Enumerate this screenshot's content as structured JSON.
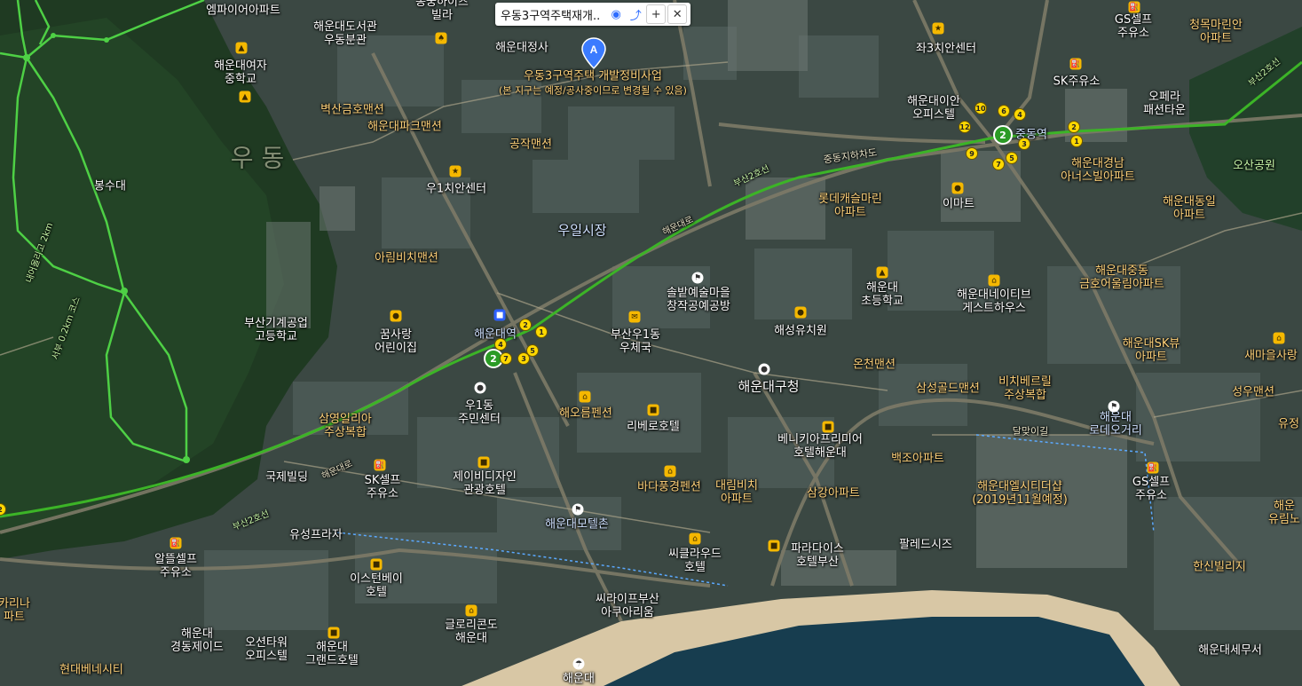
{
  "popup": {
    "title": "우동3구역주택재개.."
  },
  "pin_letter": "A",
  "notice": {
    "line1": "우동3구역주택 개발정비사업",
    "line2": "(본 지구는 예정/공사중이므로 변경될 수 있음)"
  },
  "subway_line": "2",
  "labels": {
    "empire": "엠파이어아파트",
    "haeundae_library": "해운대도서관\n우동분관",
    "villa": "동궁하이츠\n빌라",
    "haeundae_temple": "해운대정사",
    "girls_ms": "해운대여자\n중학교",
    "byeoksan": "벽산금호맨션",
    "park_mansion": "해운대파크맨션",
    "gongjak": "공작맨션",
    "u1_center": "우1치안센터",
    "u_dong": "우  동",
    "bongsudae": "봉수대",
    "trail1": "내어올리고 2km",
    "trail2": "서부 0.2km 코스",
    "uil_market": "우일시장",
    "arim": "아림비치맨션",
    "busan_mech": "부산기계공업\n고등학교",
    "dream_kinder": "꿈사랑\n어린이집",
    "haeundae_stn": "해운대역",
    "u1dong_center": "우1동\n주민센터",
    "samyoung": "삼영일리아\n주상복합",
    "haeoreum": "해오름펜션",
    "riviera": "리베로호텔",
    "solbat": "솔밭예술마을\n창작공예공방",
    "busan_post": "부산우1동\n우체국",
    "haeseong_kinder": "해성유치원",
    "gu_office": "해운대구청",
    "onchun": "온천맨션",
    "samsung_golden": "삼성골드맨션",
    "bichi_berrill": "비치베르릴\n주상복합",
    "jaseo3": "좌3치안센터",
    "haeundae_ian": "해운대이안\n오피스텔",
    "jungdong_stn": "중동역",
    "gs1": "GS셀프\n주유소",
    "blue_marina": "청목마린안\n아파트",
    "sk_oil": "SK주유소",
    "opera": "오페라\n패션타운",
    "grand_nurse": "해운대경남\n아너스빌아파트",
    "osan_park": "오산공원",
    "dongil": "해운대동일\n아파트",
    "lotte_castle": "롯데캐슬마린\n아파트",
    "emart": "이마트",
    "haeundae_elem": "해운대\n초등학교",
    "native_gh": "해운대네이티브\n게스트하우스",
    "jungdong_olympic": "해운대중동\n금호어울림아파트",
    "sk_view": "해운대SK뷰\n아파트",
    "saemaeul": "새마을사랑",
    "seongwoo": "성우맨션",
    "yujeong": "유정",
    "lotte_gohi": "해운대\n로데오거리",
    "venetia": "베니키아프리미어\n호텔해운대",
    "baekjo": "백조아파트",
    "elcity": "해운대엘시티더샵\n(2019년11월예정)",
    "gs2": "GS셀프\n주유소",
    "yurim": "해운\n유림노",
    "hanshin": "한신빌리지",
    "gukje": "국제빌딩",
    "sk_self": "SK셀프\n주유소",
    "jbd": "제이비디자인\n관광호텔",
    "batapung": "바다풍경펜션",
    "dalim_beach": "대림비치\n아파트",
    "samgang": "삼강아파트",
    "motel_zone": "해운대모텔촌",
    "yuseong": "유성프라자",
    "altel": "알뜰셀프\n주유소",
    "eastern_bay": "이스턴베이\n호텔",
    "paradise": "파라다이스\n호텔부산",
    "palace": "팔레드시즈",
    "cloud": "씨클라우드\n호텔",
    "sea_life": "씨라이프부산\n아쿠아리움",
    "glory": "글로리콘도\n해운대",
    "gyeongdong": "해운대\n경동제이드",
    "ocean_tower": "오션타워\n오피스텔",
    "grand_hotel": "해운대\n그랜드호텔",
    "hyundai": "현대베네시티",
    "beach": "해운대",
    "tax_office": "해운대세무서",
    "karina": "카리나\n파트",
    "jungdong_tunnel": "중동지하차도",
    "dalmaji": "달맞이길",
    "busan2_1": "부산2호선",
    "busan2_2": "부산2호선",
    "busan2_3": "부산2호선",
    "haeundae_daero1": "해운대로",
    "haeundae_daero2": "해운대로",
    "daero3": "해운대로"
  }
}
